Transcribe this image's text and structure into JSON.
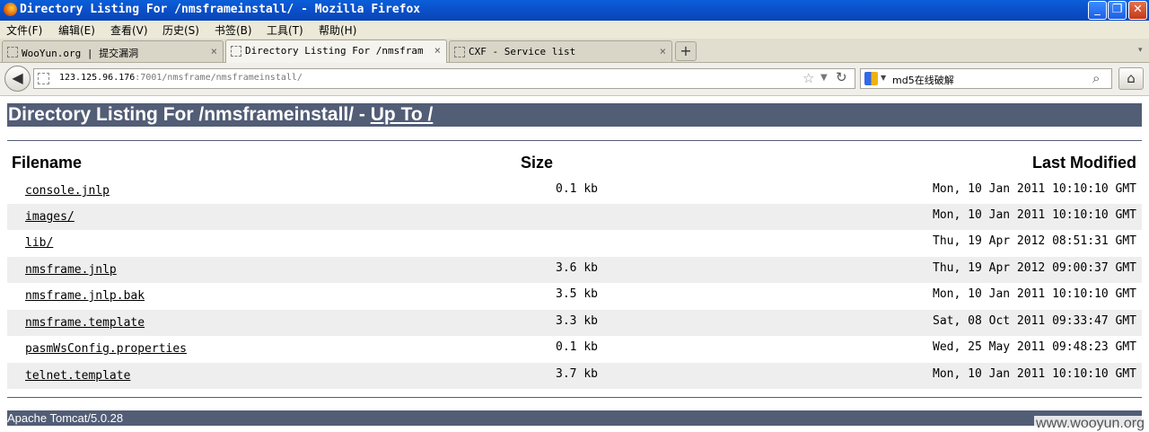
{
  "window": {
    "title": "Directory Listing For /nmsframeinstall/ - Mozilla Firefox",
    "controls": {
      "minimize": "_",
      "maximize": "❐",
      "close": "✕"
    }
  },
  "menu": [
    "文件(F)",
    "编辑(E)",
    "查看(V)",
    "历史(S)",
    "书签(B)",
    "工具(T)",
    "帮助(H)"
  ],
  "tabs": [
    {
      "label": "WooYun.org | 提交漏洞",
      "close": "×"
    },
    {
      "label": "Directory Listing For /nmsframei…",
      "close": "×"
    },
    {
      "label": "CXF - Service list",
      "close": "×"
    }
  ],
  "new_tab": "+",
  "address": {
    "host": "123.125.96.176",
    "path": ":7001/nmsframe/nmsframeinstall/"
  },
  "search": {
    "query": "md5在线破解"
  },
  "page": {
    "heading_prefix": "Directory Listing For /nmsframeinstall/ - ",
    "up_link": "Up To /",
    "columns": {
      "filename": "Filename",
      "size": "Size",
      "modified": "Last Modified"
    },
    "files": [
      {
        "name": "console.jnlp",
        "size": "0.1 kb",
        "modified": "Mon, 10 Jan 2011 10:10:10 GMT"
      },
      {
        "name": "images/",
        "size": "",
        "modified": "Mon, 10 Jan 2011 10:10:10 GMT"
      },
      {
        "name": "lib/",
        "size": "",
        "modified": "Thu, 19 Apr 2012 08:51:31 GMT"
      },
      {
        "name": "nmsframe.jnlp",
        "size": "3.6 kb",
        "modified": "Thu, 19 Apr 2012 09:00:37 GMT"
      },
      {
        "name": "nmsframe.jnlp.bak",
        "size": "3.5 kb",
        "modified": "Mon, 10 Jan 2011 10:10:10 GMT"
      },
      {
        "name": "nmsframe.template",
        "size": "3.3 kb",
        "modified": "Sat, 08 Oct 2011 09:33:47 GMT"
      },
      {
        "name": "pasmWsConfig.properties",
        "size": "0.1 kb",
        "modified": "Wed, 25 May 2011 09:48:23 GMT"
      },
      {
        "name": "telnet.template",
        "size": "3.7 kb",
        "modified": "Mon, 10 Jan 2011 10:10:10 GMT"
      }
    ],
    "footer": "Apache Tomcat/5.0.28"
  },
  "watermark": "www.wooyun.org",
  "colors": {
    "tomcat_bar": "#525d76",
    "row_alt": "#eeeeee",
    "titlebar": "#0b4fc9"
  }
}
